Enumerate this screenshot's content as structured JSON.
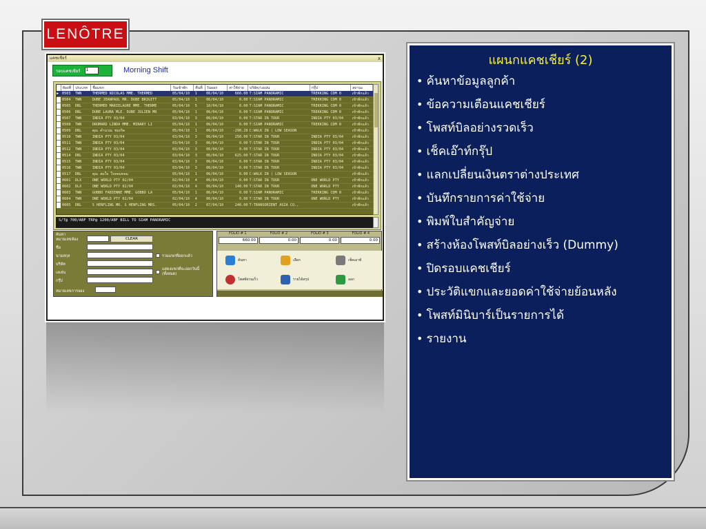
{
  "logo": {
    "part1": "LE",
    "part2": "NÔTRE"
  },
  "app": {
    "window_title": "แคชเชียร์",
    "close_glyph": "x",
    "shift_caption": "รอบแคชเชียร์",
    "shift_value": "1",
    "shift_name": "Morning Shift",
    "columns": [
      "ห้องที่",
      "ประเภท",
      "ชื่อแขก",
      "วันเข้าพัก",
      "คืนที่",
      "วันออก",
      "ค่าใช้จ่าย",
      "บริษัท/เอเย่น",
      "กรุ๊ป",
      "สถานะ"
    ],
    "rows": [
      [
        "0503",
        "TWN",
        "THERMED NICOLAS MME. THERMED",
        "05/04/10",
        "1",
        "06/04/10",
        "660.00",
        "T:SIAM PANORAMIC",
        "TREKKING CDM 0",
        "เข้าพักแล้ว"
      ],
      [
        "0504",
        "TWN",
        "DUBE JEANPAUL MR. DUBE BRIGITT",
        "05/04/10",
        "1",
        "06/04/10",
        "0.00",
        "T:SIAM PANORAMIC",
        "TREKKING CDM 0",
        "เข้าพักแล้ว"
      ],
      [
        "0505",
        "DBL",
        "THERMED MARIELAURE MME. THERME",
        "05/04/10",
        "5",
        "10/04/10",
        "0.00",
        "T:SIAM PANORAMIC",
        "TREKKING CDM 0",
        "เข้าพักแล้ว"
      ],
      [
        "0506",
        "DBL",
        "DUBE LAURA MLE. DUBE JULIEN MR",
        "05/04/10",
        "1",
        "06/04/10",
        "0.00",
        "T:SIAM PANORAMIC",
        "TREKKING CDM 0",
        "เข้าพักแล้ว"
      ],
      [
        "0507",
        "TWN",
        "INDIA PTY 03/04",
        "03/04/10",
        "3",
        "06/04/10",
        "0.00",
        "T:STAR IN TOUR",
        "INDIA PTY 03/04",
        "เข้าพักแล้ว"
      ],
      [
        "0508",
        "TWN",
        "DROMARD LINDA MME. MINARY LI",
        "05/04/10",
        "1",
        "06/04/10",
        "0.00",
        "T:SIAM PANORAMIC",
        "TREKKING CDM 0",
        "เข้าพักแล้ว"
      ],
      [
        "0509",
        "DBL",
        "คุณ คำนวณ ชมเกิด",
        "05/04/10",
        "1",
        "06/04/10",
        "-290.28",
        "C:WALK IN ( LOW SEASON",
        "",
        "เข้าพักแล้ว"
      ],
      [
        "0510",
        "TWN",
        "INDIA PTY 03/04",
        "03/04/10",
        "3",
        "06/04/10",
        "250.00",
        "T:STAR IN TOUR",
        "INDIA PTY 03/04",
        "เข้าพักแล้ว"
      ],
      [
        "0511",
        "TWN",
        "INDIA PTY 03/04",
        "03/04/10",
        "3",
        "06/04/10",
        "0.00",
        "T:STAR IN TOUR",
        "INDIA PTY 03/04",
        "เข้าพักแล้ว"
      ],
      [
        "0512",
        "TWN",
        "INDIA PTY 03/04",
        "03/04/10",
        "3",
        "06/04/10",
        "0.00",
        "T:STAR IN TOUR",
        "INDIA PTY 03/04",
        "เข้าพักแล้ว"
      ],
      [
        "0514",
        "DBL",
        "INDIA PTY 03/04",
        "03/04/10",
        "3",
        "06/04/10",
        "625.00",
        "T:STAR IN TOUR",
        "INDIA PTY 03/04",
        "เข้าพักแล้ว"
      ],
      [
        "0515",
        "TWN",
        "INDIA PTY 03/04",
        "03/04/10",
        "3",
        "06/04/10",
        "0.00",
        "T:STAR IN TOUR",
        "INDIA PTY 03/04",
        "เข้าพักแล้ว"
      ],
      [
        "0516",
        "TWN",
        "INDIA PTY 03/04",
        "03/04/10",
        "3",
        "06/04/10",
        "0.00",
        "T:STAR IN TOUR",
        "INDIA PTY 03/04",
        "เข้าพักแล้ว"
      ],
      [
        "0517",
        "DBL",
        "คุณ สมใจ ใจหอมหอม",
        "05/04/10",
        "1",
        "06/04/10",
        "0.00",
        "C:WALK IN ( LOW SEASON",
        "",
        "เข้าพักแล้ว"
      ],
      [
        "0601",
        "DLX",
        "ONE WORLD PTY 02/04",
        "02/04/10",
        "4",
        "06/04/10",
        "0.00",
        "T:STAR IN TOUR",
        "ONE WORLD PTY",
        "เข้าพักแล้ว"
      ],
      [
        "0602",
        "DLX",
        "ONE WORLD PTY 02/04",
        "02/04/10",
        "4",
        "06/04/10",
        "140.00",
        "T:STAR IN TOUR",
        "ONE WORLD PTY",
        "เข้าพักแล้ว"
      ],
      [
        "0603",
        "TWN",
        "GOBBO FABIENNE MME. GOBBO LA",
        "05/04/10",
        "1",
        "06/04/10",
        "0.00",
        "T:SIAM PANORAMIC",
        "TREKKING CDM 0",
        "เข้าพักแล้ว"
      ],
      [
        "0604",
        "TWN",
        "ONE WORLD PTY 02/04",
        "02/04/10",
        "4",
        "06/04/10",
        "0.00",
        "T:STAR IN TOUR",
        "ONE WORLD PTY",
        "เข้าพักแล้ว"
      ],
      [
        "0605",
        "DBL",
        "S HENFLING MR. S HENFLING MRS.",
        "05/04/10",
        "2",
        "07/04/10",
        "240.00",
        "T:TRANSORIENT ASIA CO.,",
        "",
        "เข้าพักแล้ว"
      ]
    ],
    "remark": "S/T@ 700/ABF  TRP@ 1200/ABF   BILL TO SIAM PANORAMIC",
    "search": {
      "header": "ค้นหา",
      "room_label": "หมายเลขห้อง",
      "name_label": "ชื่อ",
      "surname_label": "นามสกุล",
      "company_label": "บริษัท",
      "agent_label": "เอเย่น",
      "group_label": "กรุ๊ป",
      "booking_label": "หมายเลขการจอง",
      "clear_label": "CLEAR",
      "check1_label": "รวมแขกที่ออกแล้ว",
      "check2_label": "แสดงแขกที่จะออกวันนี้ (ทั้งหมด)"
    },
    "folio": {
      "labels": [
        "FOLIO # 1",
        "FOLIO # 2",
        "FOLIO # 3",
        "FOLIO # 4"
      ],
      "values": [
        "660.00",
        "0.00",
        "0.00",
        "0.00"
      ]
    },
    "actions": [
      {
        "label": "ค้นหา",
        "icon": "search-icon",
        "color": "#2a7fd4"
      },
      {
        "label": "เลือก",
        "icon": "select-icon",
        "color": "#e0a020"
      },
      {
        "label": "เช็คเอาท์",
        "icon": "checkout-icon",
        "color": "#7a7a7a"
      },
      {
        "label": "โพสท์ด่วนเร็ว",
        "icon": "clock-icon",
        "color": "#c03030"
      },
      {
        "label": "รายได้สรุป",
        "icon": "report-icon",
        "color": "#3060b0"
      },
      {
        "label": "ออก",
        "icon": "exit-icon",
        "color": "#2e9a40"
      }
    ]
  },
  "panel": {
    "title": "แผนกแคชเชียร์ (2)",
    "title_color": "#f7ef38",
    "bg_color": "#0b1f5c",
    "items": [
      "ค้นหาข้อมูลลูกค้า",
      "ข้อความเตือนแคชเชียร์",
      "โพสท์บิลอย่างรวดเร็ว",
      "เช็คเอ๊าท์กรุ๊ป",
      "แลกเปลี่ยนเงินตราต่างประเทศ",
      "บันทึกรายการค่าใช้จ่าย",
      "พิมพ์ใบสำคัญจ่าย",
      "สร้างห้องโพสท์บิลอย่างเร็ว (Dummy)",
      "ปิดรอบแคชเชียร์",
      "ประวัติแขกและยอดค่าใช้จ่ายย้อนหลัง",
      "โพสท์มินิบาร์เป็นรายการได้",
      "รายงาน"
    ]
  }
}
